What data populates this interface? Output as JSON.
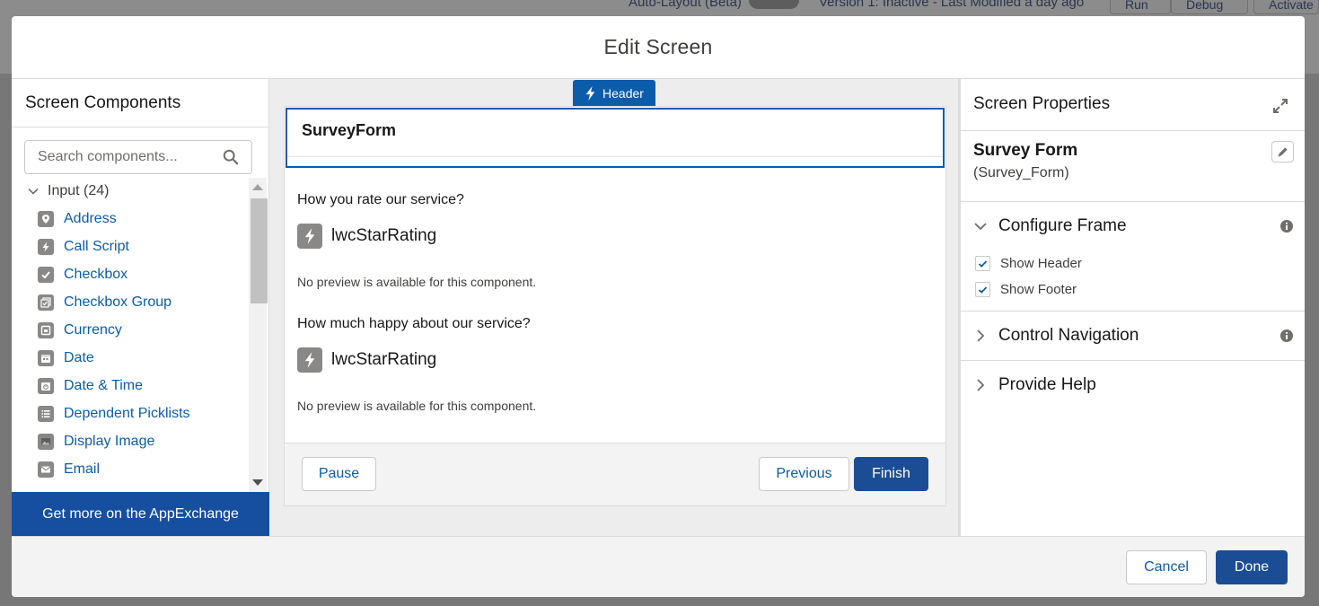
{
  "background": {
    "auto_layout": "Auto-Layout (Beta)",
    "version": "Version 1: Inactive - Last Modified a day ago",
    "run": "Run",
    "debug": "Debug",
    "activate": "Activate"
  },
  "modal": {
    "title": "Edit Screen",
    "cancel_label": "Cancel",
    "done_label": "Done"
  },
  "components": {
    "title": "Screen Components",
    "search_placeholder": "Search components...",
    "group_label": "Input (24)",
    "items": [
      {
        "label": "Address",
        "icon": "location-icon"
      },
      {
        "label": "Call Script",
        "icon": "lightning-icon"
      },
      {
        "label": "Checkbox",
        "icon": "check-icon"
      },
      {
        "label": "Checkbox Group",
        "icon": "multi-check-icon"
      },
      {
        "label": "Currency",
        "icon": "currency-icon"
      },
      {
        "label": "Date",
        "icon": "calendar-icon"
      },
      {
        "label": "Date & Time",
        "icon": "calendar-clock-icon"
      },
      {
        "label": "Dependent Picklists",
        "icon": "list-icon"
      },
      {
        "label": "Display Image",
        "icon": "image-icon"
      },
      {
        "label": "Email",
        "icon": "email-icon"
      }
    ],
    "appexchange_label": "Get more on the AppExchange"
  },
  "canvas": {
    "header_tag": "Header",
    "screen_title": "SurveyForm",
    "q1": "How you rate our service?",
    "q2": "How much happy about our service?",
    "lwc1": "lwcStarRating",
    "lwc2": "lwcStarRating",
    "nopreview1": "No preview is available for this component.",
    "nopreview2": "No preview is available for this component.",
    "pause_label": "Pause",
    "previous_label": "Previous",
    "finish_label": "Finish"
  },
  "properties": {
    "title": "Screen Properties",
    "label": "Survey Form",
    "api_name": "(Survey_Form)",
    "configure_frame": "Configure Frame",
    "show_header": "Show Header",
    "show_footer": "Show Footer",
    "control_navigation": "Control Navigation",
    "provide_help": "Provide Help"
  },
  "colors": {
    "brand": "#1b4d95",
    "link": "#0b5cab",
    "icon_gray": "#8a8886"
  }
}
